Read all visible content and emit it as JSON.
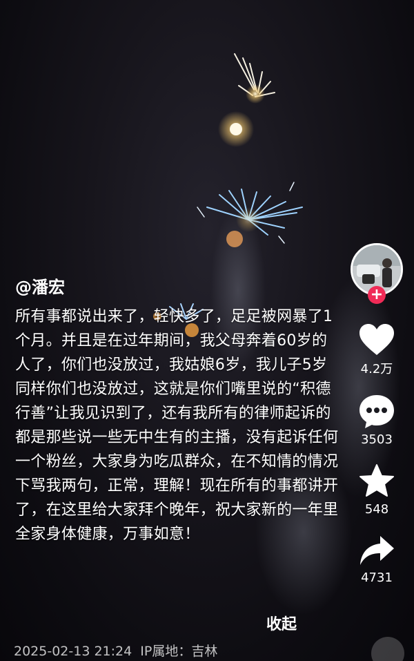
{
  "post": {
    "username": "@潘宏",
    "caption": "所有事都说出来了，轻快多了，足足被网暴了1个月。并且是在过年期间，我父母奔着60岁的人了，你们也没放过，我姑娘6岁，我儿子5岁同样你们也没放过，这就是你们嘴里说的“积德行善”让我见识到了，还有我所有的律师起诉的都是那些说一些无中生有的主播，没有起诉任何一个粉丝，大家身为吃瓜群众，在不知情的情况下骂我两句，正常，理解！现在所有的事都讲开了，在这里给大家拜个晚年，祝大家新的一年里全家身体健康，万事如意！",
    "collapse_label": "收起",
    "datetime": "2025-02-13 21:24",
    "ip_location": "IP属地：吉林"
  },
  "actions": {
    "follow_label": "+",
    "likes": "4.2万",
    "comments": "3503",
    "favorites": "548",
    "shares": "4731"
  },
  "colors": {
    "follow_red": "#f02b57",
    "text": "#ffffff"
  },
  "icons": [
    "heart-icon",
    "comment-icon",
    "star-icon",
    "share-icon"
  ]
}
